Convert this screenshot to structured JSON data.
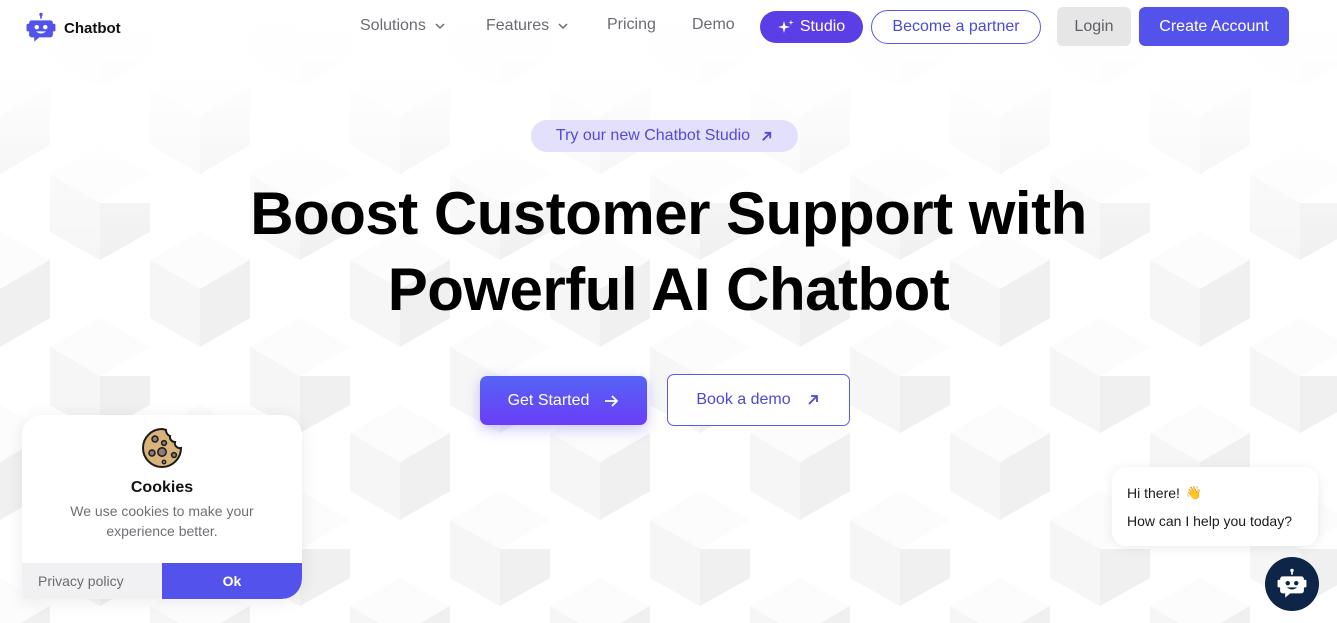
{
  "nav": {
    "brand": "Chatbot",
    "links": [
      {
        "label": "Solutions",
        "has_dropdown": true
      },
      {
        "label": "Features",
        "has_dropdown": true
      },
      {
        "label": "Pricing",
        "has_dropdown": false
      },
      {
        "label": "Demo",
        "has_dropdown": false
      }
    ],
    "studio_label": "Studio",
    "partner_label": "Become a partner",
    "login_label": "Login",
    "create_account_label": "Create Account"
  },
  "hero": {
    "announcement": "Try our new Chatbot Studio",
    "headline_line1": "Boost Customer Support with",
    "headline_line2": "Powerful AI Chatbot",
    "primary_cta": "Get Started",
    "secondary_cta": "Book a demo"
  },
  "cookie_banner": {
    "title": "Cookies",
    "message": "We use cookies to make your experience better.",
    "privacy_label": "Privacy policy",
    "ok_label": "Ok"
  },
  "chat_widget": {
    "greeting": "Hi there!",
    "greeting_emoji": "👋",
    "prompt": "How can I help you today?"
  },
  "colors": {
    "brand_primary": "#5353ec",
    "studio_purple": "#5b3ee6",
    "pill_bg": "#e3e0fc",
    "chat_launcher": "#0f2547"
  }
}
